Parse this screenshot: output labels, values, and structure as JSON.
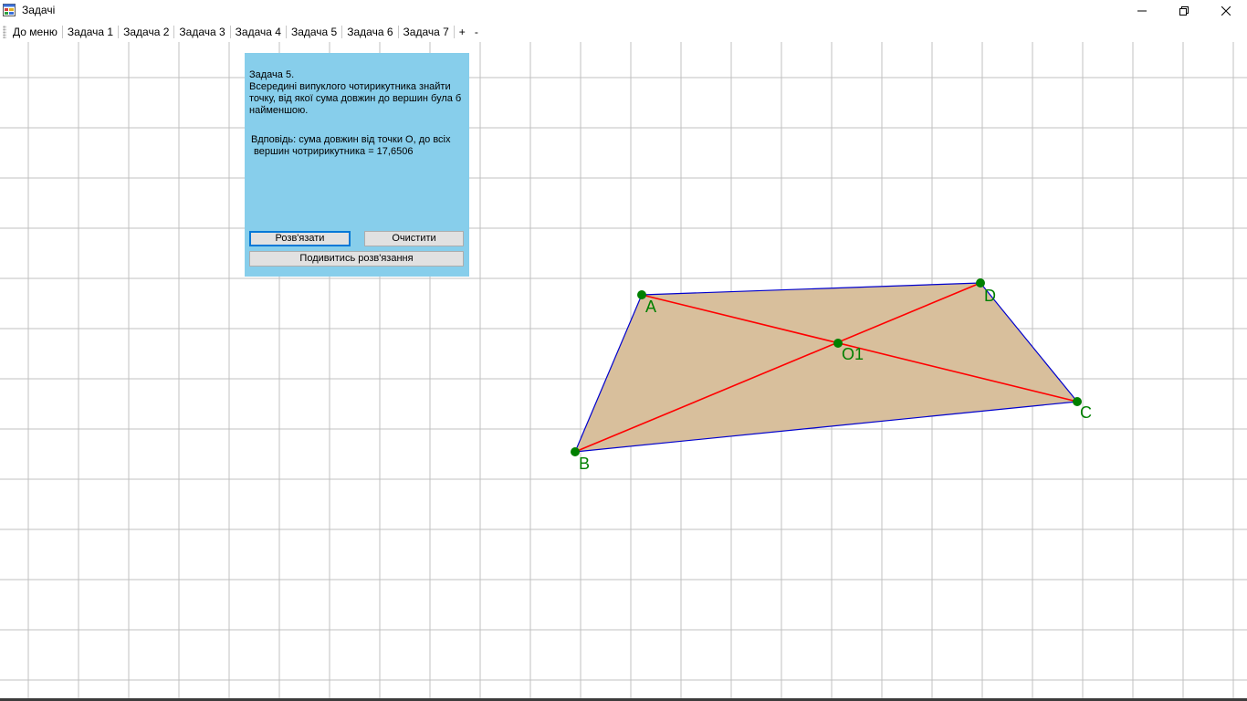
{
  "window": {
    "title": "Задачі",
    "icon": "app-window-icon",
    "controls": [
      "minimize-icon",
      "maximize-icon",
      "close-icon"
    ]
  },
  "menu": {
    "items": [
      "До меню",
      "Задача 1",
      "Задача 2",
      "Задача 3",
      "Задача 4",
      "Задача 5",
      "Задача 6",
      "Задача 7",
      "+",
      "-"
    ]
  },
  "panel": {
    "task_title": "Задача 5.",
    "task_text": "Всередині випуклого чотирикутника знайти точку, від якої сума довжин до вершин була б найменшою.",
    "answer_line1": "Вдповідь: сума довжин від точки О, до всіх",
    "answer_line2": " вершин чотририкутника = 17,6506",
    "solve_label": "Розв'язати",
    "clear_label": "Очистити",
    "view_solution_label": "Подивитись розв'язання"
  },
  "figure": {
    "points": {
      "A": "A",
      "B": "B",
      "C": "C",
      "D": "D",
      "O": "O1"
    }
  },
  "colors": {
    "panel": "#87ceeb",
    "grid": "#c0c0c0",
    "quad_fill": "#d8bf9c",
    "edges": "#0000cd",
    "diagonals": "#ff0000",
    "points": "#008000",
    "labels": "#008000",
    "focus": "#0078d7"
  }
}
